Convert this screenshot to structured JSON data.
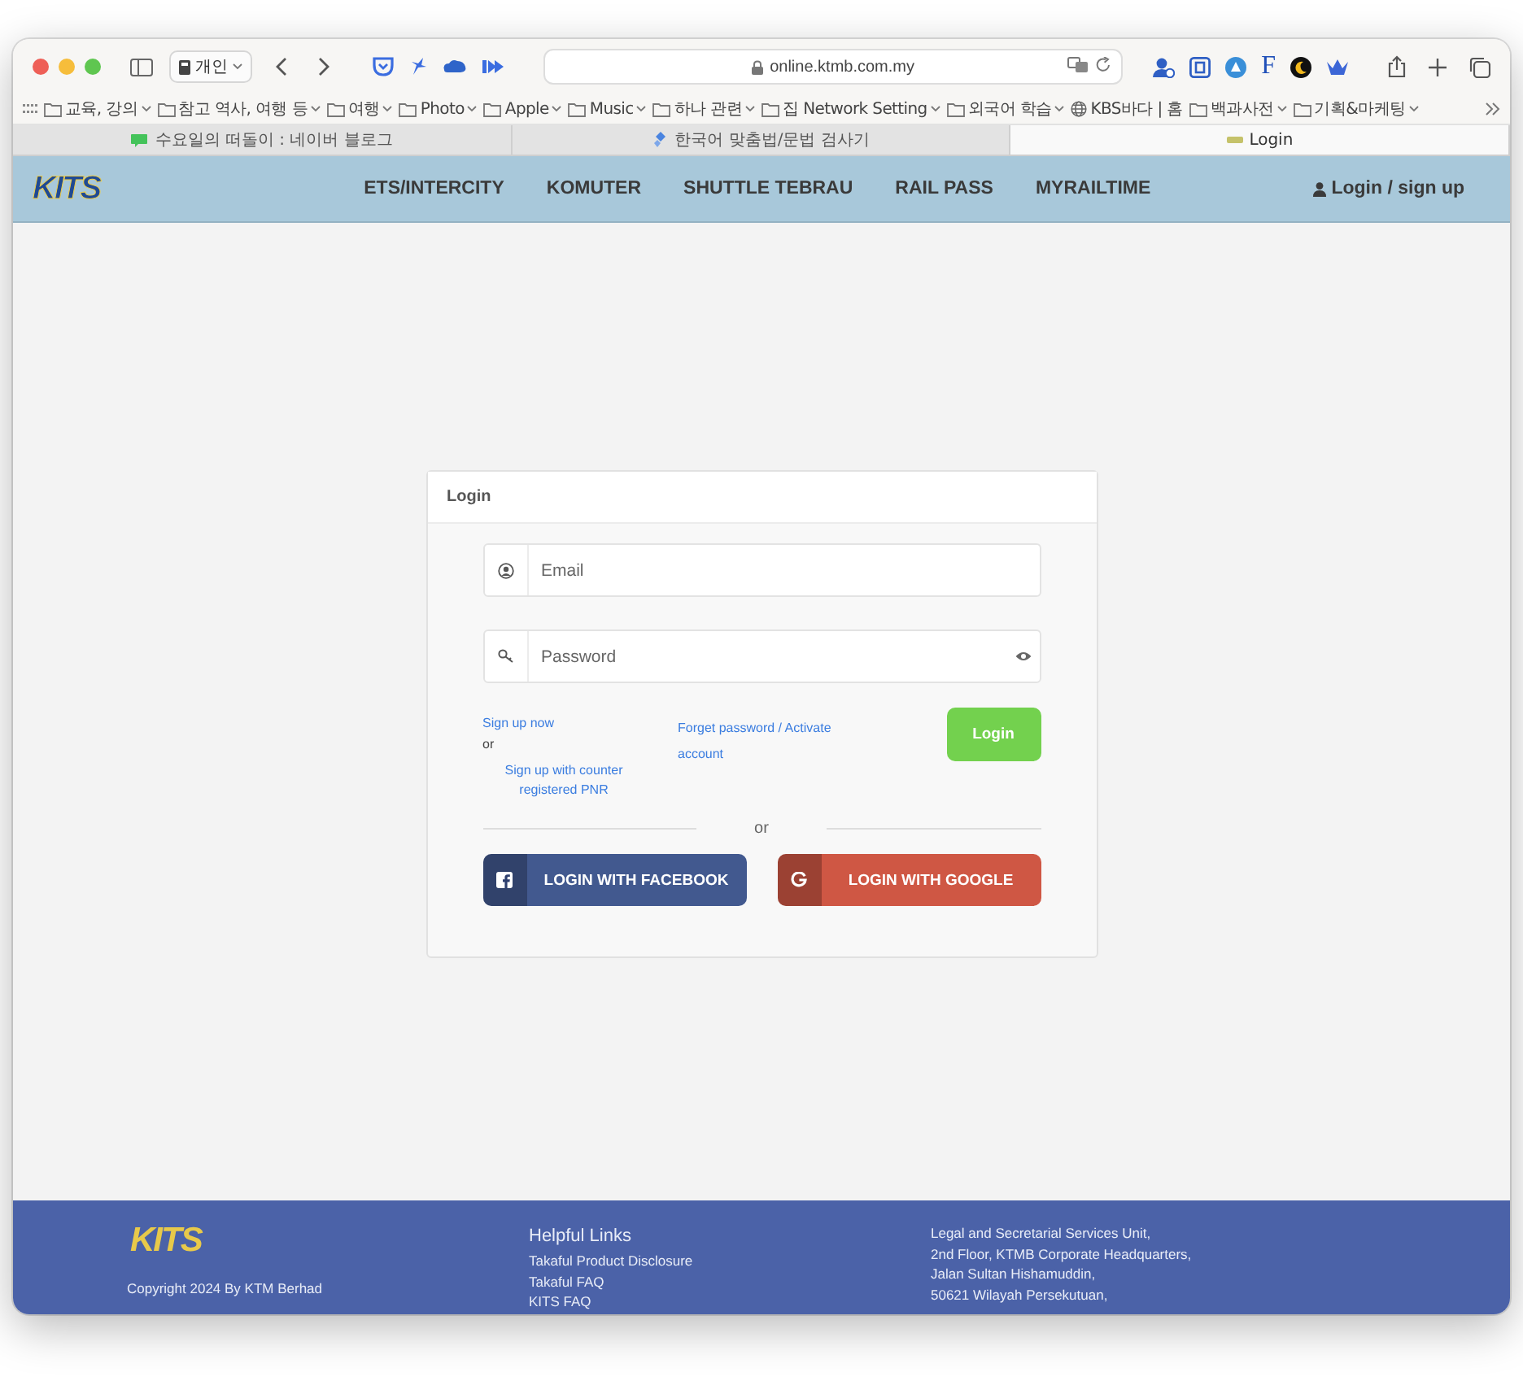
{
  "browser": {
    "profile": "개인",
    "address": "online.ktmb.com.my",
    "extension_letter": "F",
    "bookmarks": [
      {
        "label": "교육, 강의",
        "kind": "folder"
      },
      {
        "label": "참고 역사, 여행 등",
        "kind": "folder"
      },
      {
        "label": "여행",
        "kind": "folder"
      },
      {
        "label": "Photo",
        "kind": "folder"
      },
      {
        "label": "Apple",
        "kind": "folder"
      },
      {
        "label": "Music",
        "kind": "folder"
      },
      {
        "label": "하나 관련",
        "kind": "folder"
      },
      {
        "label": "집 Network Setting",
        "kind": "folder"
      },
      {
        "label": "외국어 학습",
        "kind": "folder"
      },
      {
        "label": "KBS바다 | 홈",
        "kind": "site"
      },
      {
        "label": "백과사전",
        "kind": "folder"
      },
      {
        "label": "기획&마케팅",
        "kind": "folder"
      }
    ],
    "tabs": [
      {
        "title": "수요일의 떠돌이 : 네이버 블로그",
        "kind": "blog",
        "selected": false
      },
      {
        "title": "한국어 맞춤법/문법 검사기",
        "kind": "checker",
        "selected": false
      },
      {
        "title": "Login",
        "kind": "site",
        "selected": true
      }
    ]
  },
  "site": {
    "logo": "KITS",
    "nav": [
      "ETS/INTERCITY",
      "KOMUTER",
      "SHUTTLE TEBRAU",
      "RAIL PASS",
      "MYRAILTIME"
    ],
    "account_link": "Login / sign up"
  },
  "login_card": {
    "title": "Login",
    "email": {
      "placeholder": "Email"
    },
    "password": {
      "placeholder": "Password"
    },
    "sign_up_link": "Sign up now",
    "or_small": "or",
    "counter_link": "Sign up with counter registered PNR",
    "forgot_link": "Forget password / Activate account",
    "login_button": "Login",
    "divider_text": "or",
    "social": [
      {
        "kind": "facebook",
        "label": "LOGIN WITH FACEBOOK",
        "color": "#42598f"
      },
      {
        "kind": "google",
        "label": "LOGIN WITH GOOGLE",
        "color": "#cf5744"
      }
    ]
  },
  "footer": {
    "logo": "KITS",
    "copyright": "Copyright 2024 By KTM Berhad",
    "links_title": "Helpful Links",
    "links": [
      "Takaful Product Disclosure",
      "Takaful FAQ",
      "KITS FAQ"
    ],
    "address": [
      "Legal and Secretarial Services Unit,",
      "2nd Floor, KTMB Corporate Headquarters,",
      "Jalan Sultan Hishamuddin,",
      "50621 Wilayah Persekutuan,"
    ]
  }
}
